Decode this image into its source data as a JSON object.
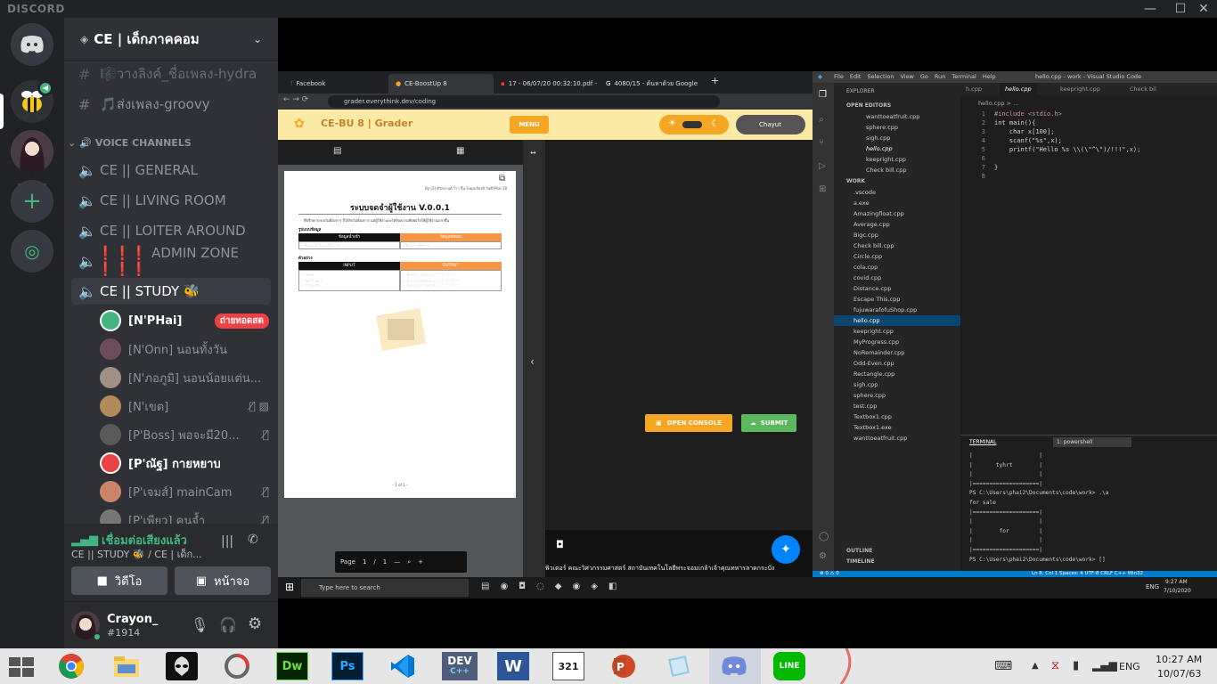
{
  "discord": {
    "brand": "DISCORD",
    "server_name": "CE | เด็กภาคคอม",
    "text_channels": [
      {
        "icon": "🎼",
        "name": "วางลิงค์_ชื่อเพลง-hydra"
      },
      {
        "icon": "🎵",
        "name": "ส่งเพลง-groovy"
      }
    ],
    "voice_header": "VOICE CHANNELS",
    "voice_channels": [
      {
        "name": "CE || GENERAL"
      },
      {
        "name": "CE || LIVING ROOM"
      },
      {
        "name": "CE || LOITER AROUND"
      },
      {
        "name": "❗❗❗ ADMIN ZONE ❗❗❗"
      },
      {
        "name": "CE || STUDY 🐝"
      }
    ],
    "voice_users": [
      {
        "name": "[N'PHai]",
        "live": "ถ่ายทอดสด",
        "color": "#ffffff"
      },
      {
        "name": "[N'Onn] นอนทั้งวัน",
        "color": "#8e9297"
      },
      {
        "name": "[N'ภอภูมิ] นอนน้อยแต่น...",
        "color": "#8e9297"
      },
      {
        "name": "[N'เขต]",
        "color": "#8e9297"
      },
      {
        "name": "[P'Boss] พอจะมี20...",
        "color": "#8e9297"
      },
      {
        "name": "[P'ณัฐ] กายหยาบ",
        "color": "#ffffff"
      },
      {
        "name": "[P'เจมส์] mainCam",
        "color": "#8e9297"
      },
      {
        "name": "[P'เพียว] คนจ้ำ",
        "color": "#8e9297"
      }
    ],
    "voice_status": "เชื่อมต่อเสียงแล้ว",
    "voice_location": "CE || STUDY 🐝 / CE | เด็ก...",
    "video_button": "วิดีโอ",
    "screen_button": "หน้าจอ",
    "user": {
      "name": "Crayon_",
      "tag": "#1914"
    },
    "accent": "#7289da",
    "live_color": "#ed4245",
    "connected_color": "#43b581"
  },
  "chrome": {
    "tabs": [
      {
        "label": "Facebook"
      },
      {
        "label": "CE-BoostUp 8"
      },
      {
        "label": "17 - 06/07/20 00:32:10.pdf -"
      },
      {
        "label": "4080/15 - ค้นหาด้วย Google"
      }
    ],
    "url": "grader.everythink.dev/coding",
    "site_title": "CE-BU 8 | Grader",
    "menu_label": "MENU",
    "user_chip": "Chayut",
    "pdf": {
      "header_meta": "By (2) ศิวัสกานต์ ว้าว จิ้น ไบคมเกียรติ วันที่ Phai 18",
      "title": "ระบบจดจำผู้ใช้งาน V.0.0.1",
      "desc": "ที่ปรึกษาระบบไม่ต้องการ ก็ได้รับไม่ต้องการ แต่ผู้ใช้งานจะได้รับความพึงพอใจให้ผู้ใช้งานมากขึ้น",
      "format_label": "รูปแบบข้อมูล",
      "in_head": "ข้อมูลนำเข้า",
      "out_head": "ข้อมูลส่งออก",
      "in_desc": "• ชื่อของผู้ใช้งานวิจัยงาน",
      "out_desc": "• คำกล่าวทักทาย",
      "example_label": "ตัวอย่าง",
      "input_head": "INPUT",
      "output_head": "OUTPUT",
      "inputs": [
        "• Java",
        "• Nattawut",
        "• Prayuth"
      ],
      "outputs": [
        "• Hello Java \\(\"^\")/!!!",
        "• Hello Nattawut \\(\"^\")/!!!",
        "• Hello Prayuth \\(\"^\")/!!!"
      ],
      "page_footer": "– 1 of 1 –",
      "page_label": "Page",
      "page_num": "1",
      "page_sep": "/",
      "page_total": "1"
    },
    "open_console": "OPEN CONSOLE",
    "submit": "SUBMIT",
    "footer_text": "พิวเตอร์ คณะวิศวกรรมศาสตร์ สถาบันเทคโนโลยีพระจอมเกล้าเจ้าคุณทหารลาดกระบัง"
  },
  "vscode": {
    "menu": [
      "File",
      "Edit",
      "Selection",
      "View",
      "Go",
      "Run",
      "Terminal",
      "Help"
    ],
    "window_title": "hello.cpp - work - Visual Studio Code",
    "explorer_label": "EXPLORER",
    "open_editors_label": "OPEN EDITORS",
    "open_editors": [
      "wanttoeatfruit.cpp",
      "sphere.cpp",
      "sigh.cpp",
      "hello.cpp",
      "keepright.cpp",
      "Check bill.cpp"
    ],
    "work_label": "WORK",
    "files": [
      ".vscode",
      "a.exe",
      "Amazingfloat.cpp",
      "Average.cpp",
      "Bigc.cpp",
      "Check bill.cpp",
      "Circle.cpp",
      "cola.cpp",
      "covid.cpp",
      "Distance.cpp",
      "Escape This.cpp",
      "fujuwarafofuShop.cpp",
      "hello.cpp",
      "keepright.cpp",
      "MyProgress.cpp",
      "NoRemainder.cpp",
      "Odd-Even.cpp",
      "Rectangle.cpp",
      "sigh.cpp",
      "sphere.cpp",
      "test.cpp",
      "Textbox1.cpp",
      "Textbox1.exe",
      "wanttoeatfruit.cpp"
    ],
    "editor_tabs": [
      "h.cpp",
      "hello.cpp",
      "keepright.cpp",
      "Check bil"
    ],
    "breadcrumb": "hello.cpp > ...",
    "code": [
      {
        "n": "1",
        "t": "#include <stdio.h>"
      },
      {
        "n": "2",
        "t": "int main(){"
      },
      {
        "n": "3",
        "t": "    char x[100];"
      },
      {
        "n": "4",
        "t": "    scanf(\"%s\",x);"
      },
      {
        "n": "5",
        "t": "    printf(\"Hello %s \\\\(\\\"^\\\")/!!!\",x);"
      },
      {
        "n": "6",
        "t": ""
      },
      {
        "n": "7",
        "t": "}"
      },
      {
        "n": "8",
        "t": ""
      }
    ],
    "terminal_label": "TERMINAL",
    "terminal_select": "1: powershell",
    "terminal_lines": [
      "|                    |",
      "|       tyhrt        |",
      "|                    |",
      "|====================|",
      "PS C:\\Users\\phai2\\Documents\\code\\work> .\\a",
      "for sale",
      "|====================|",
      "|                    |",
      "|        for         |",
      "|                    |",
      "|====================|",
      "PS C:\\Users\\phai2\\Documents\\code\\work> []"
    ],
    "outline_label": "OUTLINE",
    "timeline_label": "TIMELINE",
    "status_left": "⊗ 0 ⚠ 0",
    "status_right": "Ln 8, Col 1   Spaces: 4   UTF-8   CRLF   C++   Win32"
  },
  "inner_taskbar": {
    "search_placeholder": "Type here to search",
    "lang": "ENG",
    "time": "9:27 AM",
    "date": "7/10/2020"
  },
  "taskbar": {
    "lang": "ENG",
    "time": "10:27 AM",
    "date": "10/07/63",
    "apps": [
      "chrome-icon",
      "explorer-icon",
      "alienware-icon",
      "davinci-icon",
      "dreamweaver-icon",
      "photoshop-icon",
      "vscode-icon",
      "devcpp-icon",
      "word-icon",
      "media-321-icon",
      "powerpoint-icon",
      "notes-icon",
      "discord-icon",
      "line-icon"
    ],
    "dw_label": "Dw",
    "ps_label": "Ps",
    "dev_label": "DEV",
    "word_label": "W",
    "num_label": "321",
    "line_label": "LINE"
  }
}
